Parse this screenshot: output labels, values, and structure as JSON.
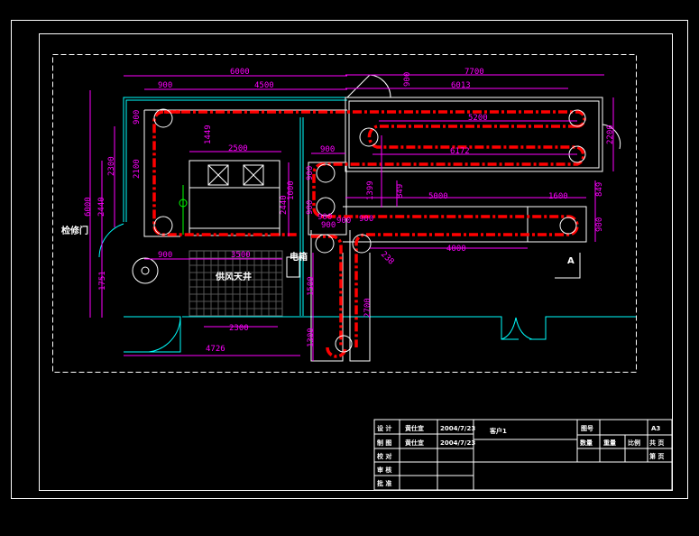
{
  "drawing": {
    "labels": {
      "door": "检修门",
      "shaft": "供风天井",
      "box": "电箱",
      "section": "A"
    },
    "dims": [
      "6000",
      "900",
      "4500",
      "7700",
      "6013",
      "5200",
      "6172",
      "900",
      "2500",
      "5000",
      "1600",
      "900",
      "900",
      "900",
      "3500",
      "2300",
      "4726",
      "4000",
      "900",
      "2100",
      "900",
      "2300",
      "2440",
      "6000",
      "1449",
      "1000",
      "2440",
      "900",
      "900",
      "1399",
      "849",
      "849",
      "900",
      "900",
      "2200",
      "1751",
      "1500",
      "2700",
      "1300",
      "238",
      "900"
    ],
    "colors": {
      "background": "#000000",
      "duct": "#ff0000",
      "dimension": "#ff00ff",
      "wall": "#00ffff",
      "outline": "#ffffff",
      "center": "#0000ff",
      "fan": "#00ff00"
    }
  },
  "title_block": {
    "rows": [
      {
        "role": "设 计",
        "name": "黄仕宜",
        "date": "2004/7/23"
      },
      {
        "role": "制 图",
        "name": "黄仕宜",
        "date": "2004/7/23"
      },
      {
        "role": "校 对",
        "name": "",
        "date": ""
      },
      {
        "role": "审 核",
        "name": "",
        "date": ""
      },
      {
        "role": "批 准",
        "name": "",
        "date": ""
      }
    ],
    "client": "客户1",
    "drawing_no_label": "图号",
    "size": "A3",
    "qty_label": "数量",
    "weight_label": "重量",
    "scale_label": "比例",
    "total_pages": "共 页",
    "page": "第 页"
  }
}
